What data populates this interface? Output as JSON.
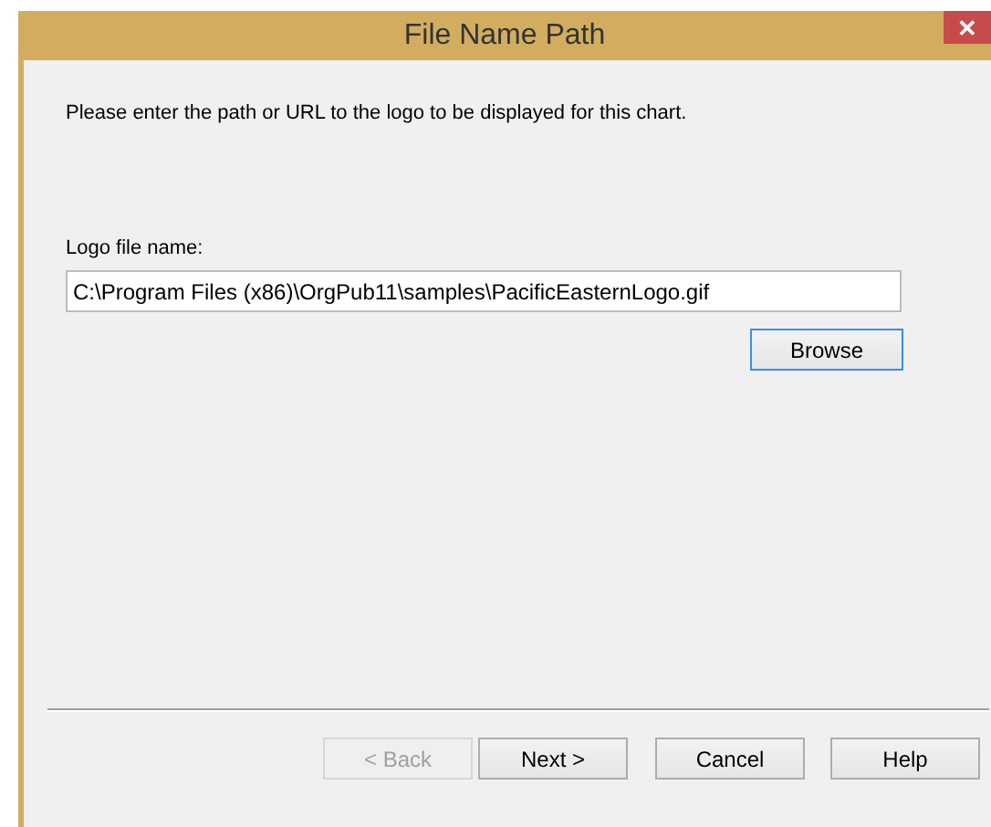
{
  "window": {
    "title": "File Name Path",
    "close": "✕"
  },
  "instructions": "Please enter the path or URL to the logo to be displayed for this chart.",
  "logo_field": {
    "label": "Logo file name:",
    "value": "C:\\Program Files (x86)\\OrgPub11\\samples\\PacificEasternLogo.gif"
  },
  "browse_button": {
    "label": "Browse",
    "focused": true,
    "disabled": false
  },
  "buttons": [
    {
      "label": "< Back",
      "disabled": true,
      "focused": false
    },
    {
      "label": "Next >",
      "disabled": false,
      "focused": false
    },
    {
      "label": "Cancel",
      "disabled": false,
      "focused": false
    },
    {
      "label": "Help",
      "disabled": false,
      "focused": false
    }
  ]
}
